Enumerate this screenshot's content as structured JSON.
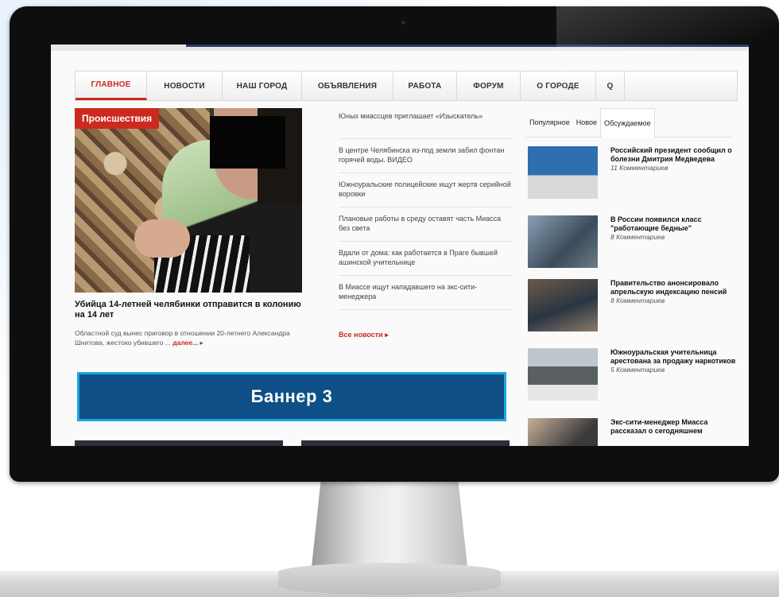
{
  "nav": {
    "items": [
      "ГЛАВНОЕ",
      "НОВОСТИ",
      "НАШ ГОРОД",
      "ОБЪЯВЛЕНИЯ",
      "РАБОТА",
      "ФОРУМ",
      "О ГОРОДЕ"
    ],
    "search_icon": "Q"
  },
  "hero": {
    "category": "Происшествия",
    "title": "Убийца 14-летней челябинки отправится в колонию на 14 лет",
    "text": "Областной суд вынес приговор в отношении 20-летнего Александра Шнитова, жестоко убившего ...",
    "more": "далее..."
  },
  "news": {
    "items": [
      "Юных миассцев приглашает «Изыскатель»",
      "В центре Челябинска из-под земли забил фонтан горячей воды. ВИДЕО",
      "Южноуральские полицейские ищут жертв серийной воровки",
      "Плановые работы в среду оставят часть Миасса без света",
      "Вдали от дома: как работается в Праге бывшей ашинской учительнице",
      "В Миассе ищут нападавшего на экс-сити-менеджера"
    ],
    "all_label": "Все новости"
  },
  "banner": {
    "label": "Баннер 3"
  },
  "tabs": [
    "Популярное",
    "Новое",
    "Обсуждаемое"
  ],
  "sidebar": {
    "items": [
      {
        "title": "Российский президент сообщил о болезни Дмитрия Медведева",
        "meta": "11 Комментариев"
      },
      {
        "title": "В России появился класс \"работающие бедные\"",
        "meta": "8 Комментариев"
      },
      {
        "title": "Правительство анонсировало апрельскую индексацию пенсий",
        "meta": "8 Комментариев"
      },
      {
        "title": "Южноуральская учительница арестована за продажу наркотиков",
        "meta": "5 Комментариев"
      },
      {
        "title": "Экс-сити-менеджер Миасса рассказал о сегодняшнем",
        "meta": ""
      }
    ]
  },
  "colors": {
    "accent": "#cc2a1f",
    "banner": "#0d4f86",
    "banner_border": "#1ea6e0",
    "bezel": "#0e0e0e"
  }
}
